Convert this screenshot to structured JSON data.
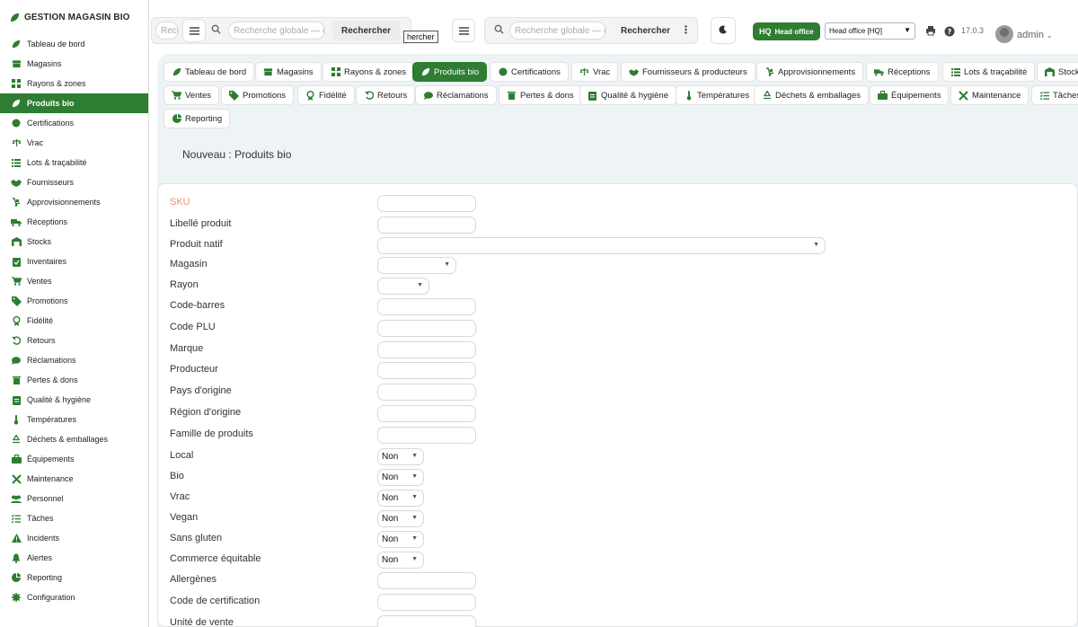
{
  "brand": {
    "name": "GESTION MAGASIN BIO",
    "icon": "leaf-icon"
  },
  "sidebar": {
    "items": [
      {
        "label": "Tableau de bord",
        "icon": "leaf-icon"
      },
      {
        "label": "Magasins",
        "icon": "store-icon"
      },
      {
        "label": "Rayons & zones",
        "icon": "grid-icon"
      },
      {
        "label": "Produits bio",
        "icon": "leaf-icon",
        "active": true
      },
      {
        "label": "Certifications",
        "icon": "certificate-icon"
      },
      {
        "label": "Vrac",
        "icon": "scale-icon"
      },
      {
        "label": "Lots & traçabilité",
        "icon": "list-icon"
      },
      {
        "label": "Fournisseurs",
        "icon": "handshake-icon"
      },
      {
        "label": "Approvisionnements",
        "icon": "dolly-icon"
      },
      {
        "label": "Réceptions",
        "icon": "truck-icon"
      },
      {
        "label": "Stocks",
        "icon": "warehouse-icon"
      },
      {
        "label": "Inventaires",
        "icon": "clipboard-check-icon"
      },
      {
        "label": "Ventes",
        "icon": "cart-icon"
      },
      {
        "label": "Promotions",
        "icon": "tag-icon"
      },
      {
        "label": "Fidélité",
        "icon": "award-icon"
      },
      {
        "label": "Retours",
        "icon": "undo-icon"
      },
      {
        "label": "Réclamations",
        "icon": "comment-icon"
      },
      {
        "label": "Pertes & dons",
        "icon": "trash-icon"
      },
      {
        "label": "Qualité & hygiène",
        "icon": "clipboard-icon"
      },
      {
        "label": "Températures",
        "icon": "thermometer-icon"
      },
      {
        "label": "Déchets & emballages",
        "icon": "recycle-icon"
      },
      {
        "label": "Équipements",
        "icon": "toolbox-icon"
      },
      {
        "label": "Maintenance",
        "icon": "tools-icon"
      },
      {
        "label": "Personnel",
        "icon": "users-icon"
      },
      {
        "label": "Tâches",
        "icon": "tasks-icon"
      },
      {
        "label": "Incidents",
        "icon": "warning-icon"
      },
      {
        "label": "Alertes",
        "icon": "bell-icon"
      },
      {
        "label": "Reporting",
        "icon": "pie-chart-icon"
      },
      {
        "label": "Configuration",
        "icon": "gear-icon"
      }
    ]
  },
  "topbar": {
    "search1_placeholder": "Recherche globale — c",
    "search2_placeholder": "Recherche globale — c",
    "search_truncated": "Rech",
    "search_btn": "Rechercher",
    "tooltip": "hercher",
    "hq_short": "HQ",
    "hq_label": "Head office",
    "hq_select": "Head office [HQ]",
    "version": "17.0.3",
    "user": "admin"
  },
  "tabs": {
    "row1": [
      {
        "label": "Tableau de bord",
        "icon": "leaf-icon"
      },
      {
        "label": "Magasins",
        "icon": "store-icon"
      },
      {
        "label": "Rayons & zones",
        "icon": "grid-icon"
      },
      {
        "label": "Produits bio",
        "icon": "leaf-icon",
        "active": true
      },
      {
        "label": "Certifications",
        "icon": "certificate-icon"
      },
      {
        "label": "Vrac",
        "icon": "scale-icon"
      },
      {
        "label": "Fournisseurs & producteurs",
        "icon": "handshake-icon"
      },
      {
        "label": "Approvisionnements",
        "icon": "dolly-icon"
      },
      {
        "label": "Réceptions",
        "icon": "truck-icon"
      },
      {
        "label": "Lots & traçabilité",
        "icon": "list-icon"
      },
      {
        "label": "Stock",
        "icon": "warehouse-icon"
      }
    ],
    "row2": [
      {
        "label": "Ventes",
        "icon": "cart-icon"
      },
      {
        "label": "Promotions",
        "icon": "tag-icon"
      },
      {
        "label": "Fidélité",
        "icon": "award-icon"
      },
      {
        "label": "Retours",
        "icon": "undo-icon"
      },
      {
        "label": "Réclamations",
        "icon": "comment-icon"
      },
      {
        "label": "Pertes & dons",
        "icon": "trash-icon"
      },
      {
        "label": "Qualité & hygiène",
        "icon": "clipboard-icon"
      },
      {
        "label": "Températures",
        "icon": "thermometer-icon"
      },
      {
        "label": "Déchets & emballages",
        "icon": "recycle-icon"
      },
      {
        "label": "Équipements",
        "icon": "toolbox-icon"
      },
      {
        "label": "Maintenance",
        "icon": "tools-icon"
      },
      {
        "label": "Tâches",
        "icon": "tasks-icon"
      }
    ],
    "row3": [
      {
        "label": "Reporting",
        "icon": "pie-chart-icon"
      }
    ]
  },
  "page": {
    "title": "Nouveau : Produits bio"
  },
  "form": {
    "fields": [
      {
        "label": "SKU",
        "type": "text",
        "required": true
      },
      {
        "label": "Libellé produit",
        "type": "text"
      },
      {
        "label": "Produit natif",
        "type": "select-wide"
      },
      {
        "label": "Magasin",
        "type": "select-mid"
      },
      {
        "label": "Rayon",
        "type": "select-small"
      },
      {
        "label": "Code-barres",
        "type": "text"
      },
      {
        "label": "Code PLU",
        "type": "text"
      },
      {
        "label": "Marque",
        "type": "text"
      },
      {
        "label": "Producteur",
        "type": "text"
      },
      {
        "label": "Pays d'origine",
        "type": "text"
      },
      {
        "label": "Région d'origine",
        "type": "text"
      },
      {
        "label": "Famille de produits",
        "type": "text"
      },
      {
        "label": "Local",
        "type": "bool",
        "value": "Non"
      },
      {
        "label": "Bio",
        "type": "bool",
        "value": "Non"
      },
      {
        "label": "Vrac",
        "type": "bool",
        "value": "Non"
      },
      {
        "label": "Vegan",
        "type": "bool",
        "value": "Non"
      },
      {
        "label": "Sans gluten",
        "type": "bool",
        "value": "Non"
      },
      {
        "label": "Commerce équitable",
        "type": "bool",
        "value": "Non"
      },
      {
        "label": "Allergènes",
        "type": "text"
      },
      {
        "label": "Code de certification",
        "type": "text"
      },
      {
        "label": "Unité de vente",
        "type": "text"
      }
    ]
  },
  "colors": {
    "accent": "#2e7d32",
    "required": "#ef8e6e",
    "panel": "#eef3f6"
  }
}
